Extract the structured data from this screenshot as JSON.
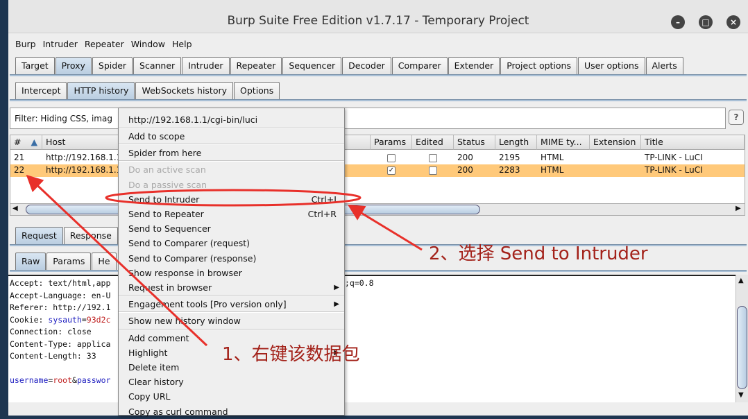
{
  "window": {
    "title": "Burp Suite Free Edition v1.7.17 - Temporary Project",
    "controls": [
      "minimize",
      "maximize",
      "close"
    ]
  },
  "menubar": [
    "Burp",
    "Intruder",
    "Repeater",
    "Window",
    "Help"
  ],
  "main_tabs": [
    "Target",
    "Proxy",
    "Spider",
    "Scanner",
    "Intruder",
    "Repeater",
    "Sequencer",
    "Decoder",
    "Comparer",
    "Extender",
    "Project options",
    "User options",
    "Alerts"
  ],
  "main_tab_selected": "Proxy",
  "proxy_tabs": [
    "Intercept",
    "HTTP history",
    "WebSockets history",
    "Options"
  ],
  "proxy_tab_selected": "HTTP history",
  "filter": {
    "text": "Filter: Hiding CSS, imag",
    "help": "?"
  },
  "table": {
    "columns": [
      "#",
      "Host",
      "Params",
      "Edited",
      "Status",
      "Length",
      "MIME ty...",
      "Extension",
      "Title"
    ],
    "sort_icon": "sort-ascending-icon",
    "rows": [
      {
        "num": "21",
        "host": "http://192.168.1.1",
        "params": false,
        "edited": false,
        "status": "200",
        "length": "2195",
        "mime": "HTML",
        "extension": "",
        "title": "TP-LINK - LuCI",
        "selected": false
      },
      {
        "num": "22",
        "host": "http://192.168.1.1",
        "params": true,
        "edited": false,
        "status": "200",
        "length": "2283",
        "mime": "HTML",
        "extension": "",
        "title": "TP-LINK - LuCI",
        "selected": true
      }
    ]
  },
  "req_tabs": [
    "Request",
    "Response"
  ],
  "view_tabs": [
    "Raw",
    "Params",
    "He"
  ],
  "editor": {
    "lines": [
      {
        "k": "Accept: text/html,app",
        "v": ""
      },
      {
        "k": "Accept-Language: en-U",
        "v": ""
      },
      {
        "k": "Referer: http://192.1",
        "v": ""
      },
      {
        "k": "Connection: close",
        "v": ""
      },
      {
        "k": "Content-Type: applica",
        "v": ""
      },
      {
        "k": "Content-Length: 33",
        "v": ""
      }
    ],
    "cookie_label": "Cookie: ",
    "cookie_name": "sysauth",
    "cookie_eq": "=",
    "cookie_val": "93d2c",
    "body_k1": "username",
    "body_eq": "=",
    "body_v1": "root",
    "body_amp": "&",
    "body_k2": "passwor",
    "tail": ";q=0.8"
  },
  "context_menu": {
    "url": "http://192.168.1.1/cgi-bin/luci",
    "items": [
      {
        "label": "Add to scope"
      },
      {
        "label": "Spider from here"
      },
      {
        "label": "Do an active scan",
        "disabled": true
      },
      {
        "label": "Do a passive scan",
        "disabled": true
      },
      {
        "label": "Send to Intruder",
        "shortcut": "Ctrl+I"
      },
      {
        "label": "Send to Repeater",
        "shortcut": "Ctrl+R"
      },
      {
        "label": "Send to Sequencer"
      },
      {
        "label": "Send to Comparer (request)"
      },
      {
        "label": "Send to Comparer (response)"
      },
      {
        "label": "Show response in browser"
      },
      {
        "label": "Request in browser",
        "submenu": true
      },
      {
        "label": "Engagement tools [Pro version only]",
        "submenu": true
      },
      {
        "label": "Show new history window"
      },
      {
        "label": "Add comment"
      },
      {
        "label": "Highlight",
        "submenu": true
      },
      {
        "label": "Delete item"
      },
      {
        "label": "Clear history"
      },
      {
        "label": "Copy URL"
      },
      {
        "label": "Copy as curl command"
      }
    ]
  },
  "annotations": {
    "step1": "1、右键该数据包",
    "step2": "2、选择 Send to Intruder",
    "color": "#a3221a",
    "arrow_color": "#e8302a"
  },
  "colors": {
    "selected_row": "#ffc97a",
    "tab_selected": "#c6d7e8",
    "key_blue": "#2020c0",
    "value_red": "#c02020"
  }
}
